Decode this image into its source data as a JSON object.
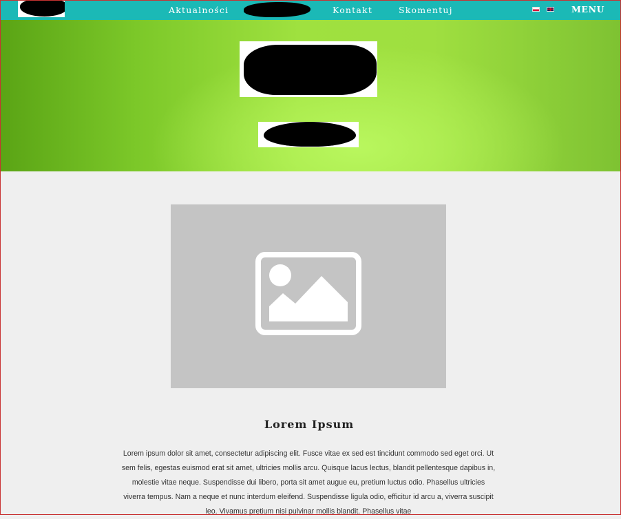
{
  "nav": {
    "items": [
      {
        "label": "Aktualności"
      },
      {
        "label": "Kontakt"
      },
      {
        "label": "Skomentuj"
      }
    ],
    "menu_label": "MENU",
    "languages": [
      "pl-flag-icon",
      "gb-flag-icon"
    ]
  },
  "colors": {
    "topbar": "#1bb9b6",
    "hero_light": "#b9f75e",
    "hero_dark": "#5aa415",
    "content_bg": "#efefef",
    "image_placeholder": "#c4c4c4"
  },
  "content": {
    "image_icon": "image-placeholder-icon",
    "title": "Lorem Ipsum",
    "body": "Lorem ipsum dolor sit amet, consectetur adipiscing elit. Fusce vitae ex sed est tincidunt commodo sed eget orci. Ut sem felis, egestas euismod erat sit amet, ultricies mollis arcu. Quisque lacus lectus, blandit pellentesque dapibus in, molestie vitae neque. Suspendisse dui libero, porta sit amet augue eu, pretium luctus odio. Phasellus ultricies viverra tempus. Nam a neque et nunc interdum eleifend. Suspendisse ligula odio, efficitur id arcu a, viverra suscipit leo. Vivamus pretium nisi pulvinar mollis blandit. Phasellus vitae"
  }
}
